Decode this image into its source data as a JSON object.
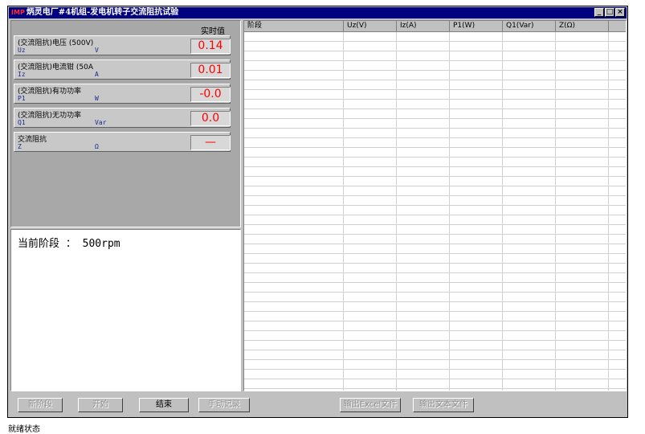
{
  "window": {
    "logo": "IMP",
    "title": "炳灵电厂#4机组-发电机转子交流阻抗试验",
    "min_btn": "_",
    "max_btn": "□",
    "close_btn": "×"
  },
  "measurements": {
    "header": "实时值",
    "rows": [
      {
        "name": "(交流阻抗)电压 (500V)",
        "symbol": "Uz",
        "unit": "V",
        "value": "0.14"
      },
      {
        "name": "(交流阻抗)电流钳 (50A",
        "symbol": "Iz",
        "unit": "A",
        "value": "0.01"
      },
      {
        "name": "(交流阻抗)有功功率",
        "symbol": "P1",
        "unit": "W",
        "value": "-0.0"
      },
      {
        "name": "(交流阻抗)无功功率",
        "symbol": "Q1",
        "unit": "Var",
        "value": "0.0"
      },
      {
        "name": "交流阻抗",
        "symbol": "Z",
        "unit": "Ω",
        "value": "—"
      }
    ]
  },
  "stage": {
    "text": "当前阶段 ： 500rpm"
  },
  "grid": {
    "columns": [
      "阶段",
      "Uz(V)",
      "Iz(A)",
      "P1(W)",
      "Q1(Var)",
      "Z(Ω)"
    ]
  },
  "buttons": {
    "new_stage": "新阶段",
    "start": "开始",
    "end": "结束",
    "manual_record": "手动记录",
    "export_excel": "输出Excel文件",
    "export_text": "输出文本文件"
  },
  "footer": {
    "text": "就绪状态"
  }
}
